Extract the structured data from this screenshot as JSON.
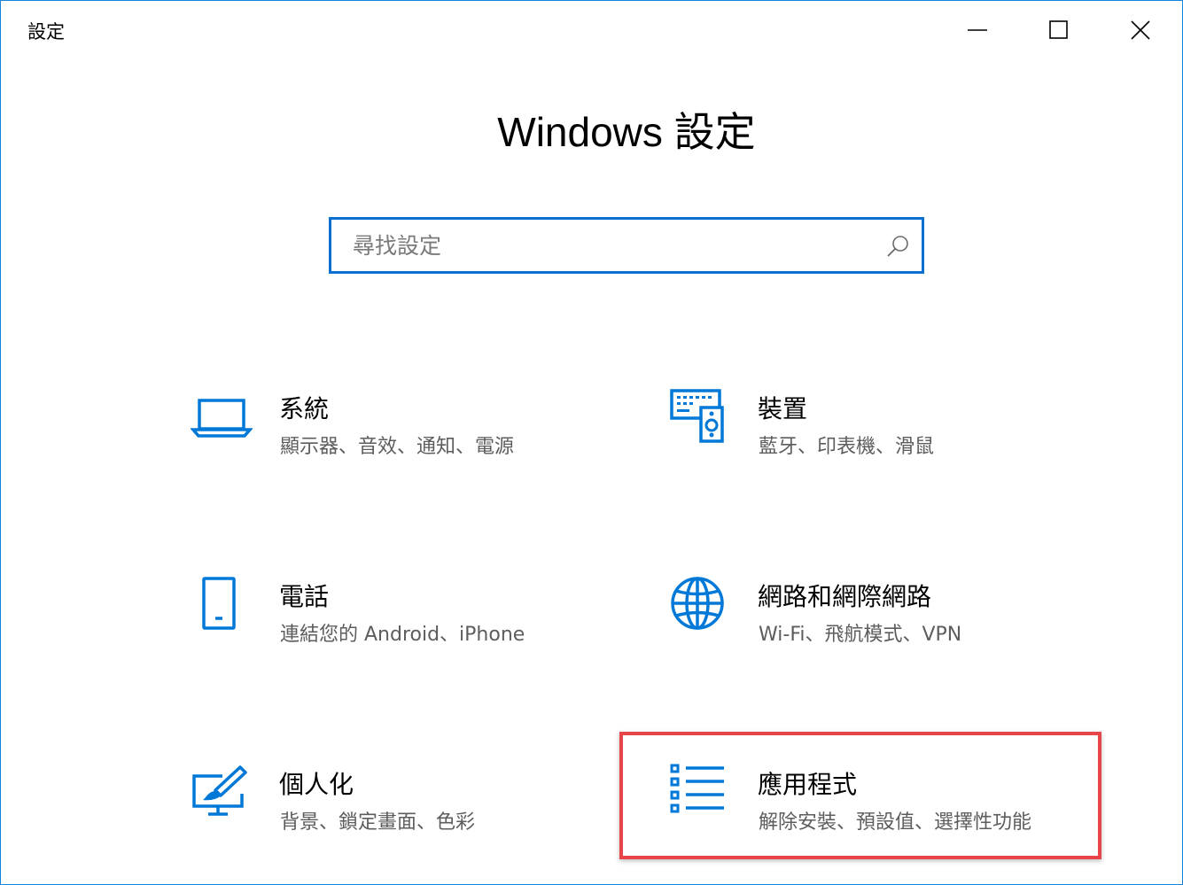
{
  "window": {
    "title": "設定",
    "controls": {
      "minimize_icon": "minimize-icon",
      "maximize_icon": "maximize-icon",
      "close_icon": "close-icon"
    }
  },
  "header": {
    "title": "Windows 設定"
  },
  "search": {
    "placeholder": "尋找設定",
    "value": "",
    "icon": "search-icon"
  },
  "tiles": [
    {
      "id": "system",
      "title": "系統",
      "subtitle": "顯示器、音效、通知、電源",
      "icon": "laptop-icon"
    },
    {
      "id": "devices",
      "title": "裝置",
      "subtitle": "藍牙、印表機、滑鼠",
      "icon": "devices-icon"
    },
    {
      "id": "phone",
      "title": "電話",
      "subtitle": "連結您的 Android、iPhone",
      "icon": "phone-icon"
    },
    {
      "id": "network",
      "title": "網路和網際網路",
      "subtitle": "Wi-Fi、飛航模式、VPN",
      "icon": "globe-icon"
    },
    {
      "id": "personalization",
      "title": "個人化",
      "subtitle": "背景、鎖定畫面、色彩",
      "icon": "personalization-icon"
    },
    {
      "id": "apps",
      "title": "應用程式",
      "subtitle": "解除安裝、預設值、選擇性功能",
      "icon": "apps-list-icon"
    }
  ],
  "colors": {
    "accent": "#0a6fd0",
    "icon": "#0078d7",
    "highlight": "#e7454a",
    "subtitle_text": "#5d5d5d",
    "window_border": "#1883d7"
  }
}
